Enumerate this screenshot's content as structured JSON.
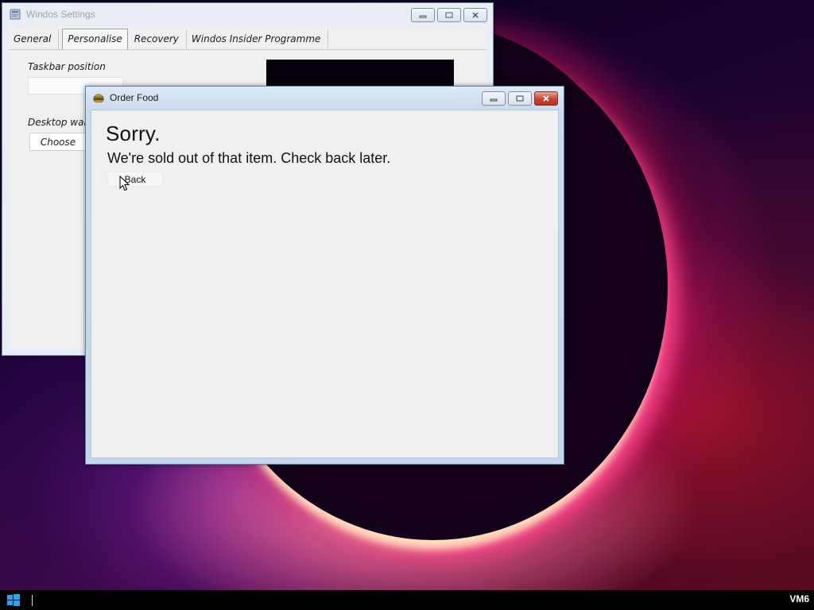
{
  "settings_window": {
    "title": "Windos Settings",
    "tabs": [
      {
        "label": "General"
      },
      {
        "label": "Personalise"
      },
      {
        "label": "Recovery"
      },
      {
        "label": "Windos Insider Programme"
      }
    ],
    "active_tab": "Personalise",
    "taskbar_position_label": "Taskbar position",
    "desktop_wallpaper_label": "Desktop wallp",
    "choose_button_label": "Choose"
  },
  "order_window": {
    "title": "Order Food",
    "heading": "Sorry.",
    "message": "We're sold out of that item. Check back later.",
    "back_button_label": "Back"
  },
  "taskbar": {
    "machine_label": "VM6"
  },
  "colors": {
    "titlebar_active": "#c9dbee",
    "close_button": "#c4432f",
    "client_bg": "#f0f0f0",
    "taskbar_bg": "#000000"
  },
  "icons": {
    "settings_window": "settings-app-icon",
    "order_window": "burger-icon",
    "start": "windows-logo-icon"
  }
}
